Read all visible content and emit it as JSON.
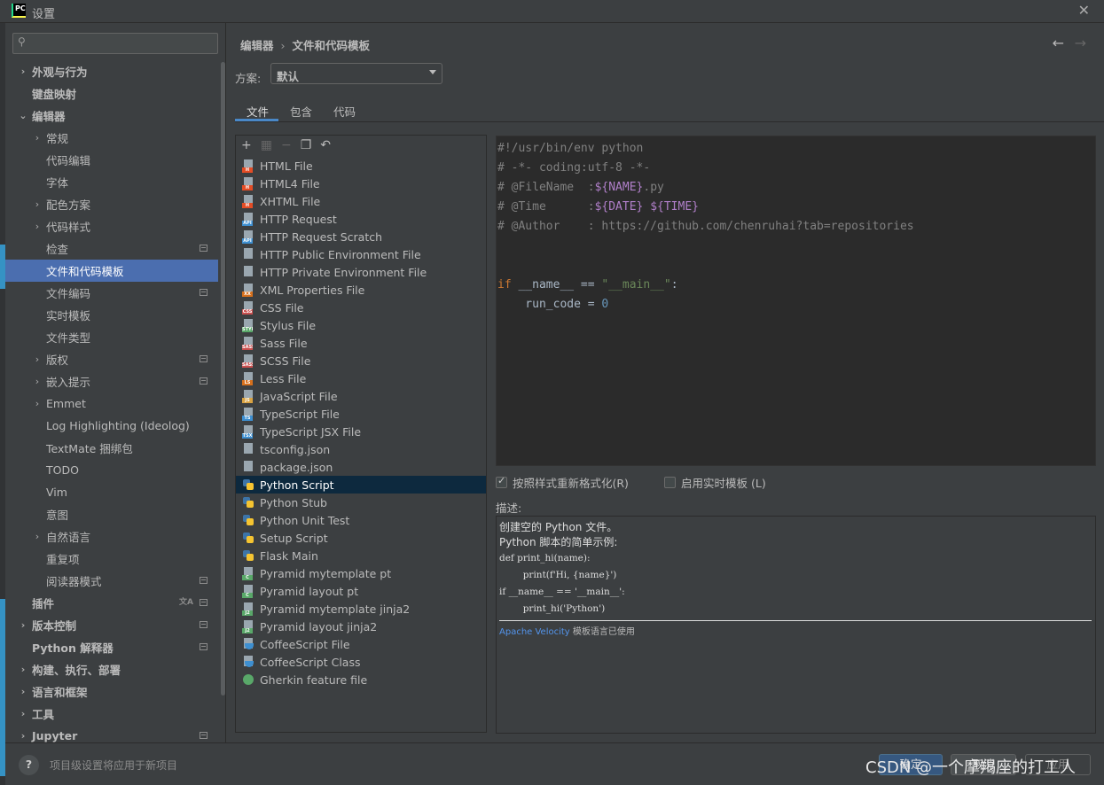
{
  "window": {
    "logo_text": "PC",
    "title": "设置"
  },
  "sidebar": {
    "items": [
      {
        "label": "外观与行为",
        "arrow": "›",
        "indent": 14,
        "bold": true
      },
      {
        "label": "键盘映射",
        "arrow": "",
        "indent": 14,
        "bold": true
      },
      {
        "label": "编辑器",
        "arrow": "⌄",
        "indent": 14,
        "bold": true
      },
      {
        "label": "常规",
        "arrow": "›",
        "indent": 30
      },
      {
        "label": "代码编辑",
        "arrow": "",
        "indent": 30
      },
      {
        "label": "字体",
        "arrow": "",
        "indent": 30
      },
      {
        "label": "配色方案",
        "arrow": "›",
        "indent": 30
      },
      {
        "label": "代码样式",
        "arrow": "›",
        "indent": 30
      },
      {
        "label": "检查",
        "arrow": "",
        "indent": 30,
        "marker": true
      },
      {
        "label": "文件和代码模板",
        "arrow": "",
        "indent": 30,
        "selected": true
      },
      {
        "label": "文件编码",
        "arrow": "",
        "indent": 30,
        "marker": true
      },
      {
        "label": "实时模板",
        "arrow": "",
        "indent": 30
      },
      {
        "label": "文件类型",
        "arrow": "",
        "indent": 30
      },
      {
        "label": "版权",
        "arrow": "›",
        "indent": 30,
        "marker": true
      },
      {
        "label": "嵌入提示",
        "arrow": "›",
        "indent": 30,
        "marker": true
      },
      {
        "label": "Emmet",
        "arrow": "›",
        "indent": 30
      },
      {
        "label": "Log Highlighting (Ideolog)",
        "arrow": "",
        "indent": 30
      },
      {
        "label": "TextMate 捆绑包",
        "arrow": "",
        "indent": 30
      },
      {
        "label": "TODO",
        "arrow": "",
        "indent": 30
      },
      {
        "label": "Vim",
        "arrow": "",
        "indent": 30
      },
      {
        "label": "意图",
        "arrow": "",
        "indent": 30
      },
      {
        "label": "自然语言",
        "arrow": "›",
        "indent": 30
      },
      {
        "label": "重复项",
        "arrow": "",
        "indent": 30
      },
      {
        "label": "阅读器模式",
        "arrow": "",
        "indent": 30,
        "marker": true
      },
      {
        "label": "插件",
        "arrow": "",
        "indent": 14,
        "bold": true,
        "marker": true,
        "lang": true
      },
      {
        "label": "版本控制",
        "arrow": "›",
        "indent": 14,
        "bold": true,
        "marker": true
      },
      {
        "label": "Python 解释器",
        "arrow": "",
        "indent": 14,
        "bold": true,
        "marker": true
      },
      {
        "label": "构建、执行、部署",
        "arrow": "›",
        "indent": 14,
        "bold": true
      },
      {
        "label": "语言和框架",
        "arrow": "›",
        "indent": 14,
        "bold": true
      },
      {
        "label": "工具",
        "arrow": "›",
        "indent": 14,
        "bold": true
      },
      {
        "label": "Jupyter",
        "arrow": "›",
        "indent": 14,
        "bold": true,
        "marker": true
      }
    ]
  },
  "main": {
    "breadcrumb": {
      "parent": "编辑器",
      "sep": "›",
      "current": "文件和代码模板"
    },
    "nav": {
      "back": "←",
      "forward": "→"
    },
    "scheme": {
      "label": "方案:",
      "value": "默认"
    },
    "tabs": [
      {
        "label": "文件",
        "active": true
      },
      {
        "label": "包含"
      },
      {
        "label": "代码"
      }
    ],
    "toolbar": {
      "add": "+",
      "copy_template": "▦",
      "remove": "−",
      "duplicate": "❐",
      "reset": "↶"
    }
  },
  "files": [
    {
      "name": "HTML File",
      "tag": "H",
      "color": "#e44d26"
    },
    {
      "name": "HTML4 File",
      "tag": "H",
      "color": "#e44d26"
    },
    {
      "name": "XHTML File",
      "tag": "H",
      "color": "#e44d26"
    },
    {
      "name": "HTTP Request",
      "tag": "API",
      "color": "#3d8fd1"
    },
    {
      "name": "HTTP Request Scratch",
      "tag": "API",
      "color": "#3d8fd1"
    },
    {
      "name": "HTTP Public Environment File",
      "tag": "",
      "color": "#9aa7b0"
    },
    {
      "name": "HTTP Private Environment File",
      "tag": "",
      "color": "#9aa7b0"
    },
    {
      "name": "XML Properties File",
      "tag": "XX",
      "color": "#d6701d"
    },
    {
      "name": "CSS File",
      "tag": "CSS",
      "color": "#c94f4f"
    },
    {
      "name": "Stylus File",
      "tag": "STYL",
      "color": "#59a869"
    },
    {
      "name": "Sass File",
      "tag": "SASS",
      "color": "#c94f4f"
    },
    {
      "name": "SCSS File",
      "tag": "SASS",
      "color": "#c94f4f"
    },
    {
      "name": "Less File",
      "tag": "LS",
      "color": "#d6701d"
    },
    {
      "name": "JavaScript File",
      "tag": "JS",
      "color": "#d9a343"
    },
    {
      "name": "TypeScript File",
      "tag": "TS",
      "color": "#3d8fd1"
    },
    {
      "name": "TypeScript JSX File",
      "tag": "TSX",
      "color": "#3d8fd1"
    },
    {
      "name": "tsconfig.json",
      "tag": "",
      "color": "#9aa7b0"
    },
    {
      "name": "package.json",
      "tag": "",
      "color": "#9aa7b0"
    },
    {
      "name": "Python Script",
      "tag": "py",
      "color": "",
      "selected": true
    },
    {
      "name": "Python Stub",
      "tag": "py",
      "color": ""
    },
    {
      "name": "Python Unit Test",
      "tag": "py",
      "color": ""
    },
    {
      "name": "Setup Script",
      "tag": "py",
      "color": ""
    },
    {
      "name": "Flask Main",
      "tag": "py",
      "color": ""
    },
    {
      "name": "Pyramid mytemplate pt",
      "tag": "C",
      "color": "#59a869"
    },
    {
      "name": "Pyramid layout pt",
      "tag": "C",
      "color": "#59a869"
    },
    {
      "name": "Pyramid mytemplate jinja2",
      "tag": "J2",
      "color": "#59a869"
    },
    {
      "name": "Pyramid layout jinja2",
      "tag": "J2",
      "color": "#59a869"
    },
    {
      "name": "CoffeeScript File",
      "tag": "coffee",
      "color": "#3d8fd1"
    },
    {
      "name": "CoffeeScript Class",
      "tag": "coffee",
      "color": "#3d8fd1"
    },
    {
      "name": "Gherkin feature file",
      "tag": "dot",
      "color": "#59a869"
    }
  ],
  "editor": {
    "lines": [
      [
        {
          "t": "#!/usr/bin/env python",
          "c": "comment"
        }
      ],
      [
        {
          "t": "# -*- coding:utf-8 -*-",
          "c": "comment"
        }
      ],
      [
        {
          "t": "# @FileName  :",
          "c": "comment"
        },
        {
          "t": "${NAME}",
          "c": "var"
        },
        {
          "t": ".py",
          "c": "comment"
        }
      ],
      [
        {
          "t": "# @Time      :",
          "c": "comment"
        },
        {
          "t": "${DATE}",
          "c": "var"
        },
        {
          "t": " ",
          "c": "comment"
        },
        {
          "t": "${TIME}",
          "c": "var"
        }
      ],
      [
        {
          "t": "# @Author    : https://github.com/chenruhai?tab=repositories",
          "c": "comment"
        }
      ],
      [],
      [],
      [
        {
          "t": "if",
          "c": "kw"
        },
        {
          "t": " __name__ == ",
          "c": ""
        },
        {
          "t": "\"__main__\"",
          "c": "str"
        },
        {
          "t": ":",
          "c": ""
        }
      ],
      [
        {
          "t": "    run_code = ",
          "c": ""
        },
        {
          "t": "0",
          "c": "num"
        }
      ]
    ]
  },
  "options": {
    "reformat": {
      "label": "按照样式重新格式化(R)",
      "checked": true
    },
    "live_templates": {
      "label": "启用实时模板 (L)",
      "checked": false
    }
  },
  "description": {
    "label": "描述:",
    "line1": "创建空的 Python 文件。",
    "line2": "Python 脚本的简单示例:",
    "code": [
      "def print_hi(name):",
      "        print(f'Hi, {name}')",
      "",
      "",
      "if __name__ == '__main__':",
      "        print_hi('Python')"
    ],
    "footer_link": "Apache Velocity",
    "footer_text": " 模板语言已使用"
  },
  "footer": {
    "help": "?",
    "text": "项目级设置将应用于新项目",
    "ok": "确定",
    "cancel": "取消",
    "apply": "应用"
  },
  "watermark": "CSDN @一个摩羯座的打工人"
}
